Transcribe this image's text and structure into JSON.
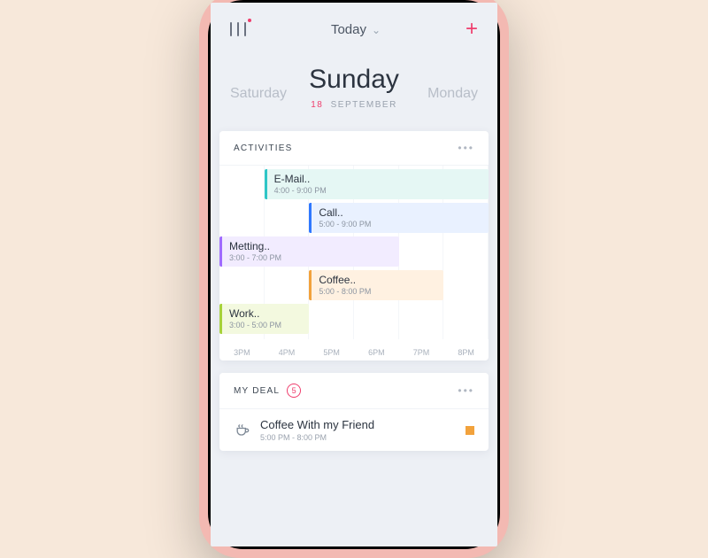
{
  "topbar": {
    "title": "Today"
  },
  "dayHeader": {
    "prev": "Saturday",
    "current": "Sunday",
    "next": "Monday",
    "dateNum": "18",
    "month": "SEPTEMBER"
  },
  "activities": {
    "title": "ACTIVITIES",
    "axis": [
      "3PM",
      "4PM",
      "5PM",
      "6PM",
      "7PM",
      "8PM"
    ],
    "events": [
      {
        "title": "E-Mail..",
        "time": "4:00 - 9:00 PM",
        "color": "#2ec6c6",
        "bg": "#e5f7f4",
        "startHour": 4.0,
        "endHour": 9.0
      },
      {
        "title": "Call..",
        "time": "5:00 - 9:00 PM",
        "color": "#2f78ff",
        "bg": "#e9f1ff",
        "startHour": 5.0,
        "endHour": 9.0
      },
      {
        "title": "Metting..",
        "time": "3:00 - 7:00 PM",
        "color": "#a06bff",
        "bg": "#f2ecff",
        "startHour": 3.0,
        "endHour": 7.0
      },
      {
        "title": "Coffee..",
        "time": "5:00 - 8:00 PM",
        "color": "#f2a23c",
        "bg": "#fff1e1",
        "startHour": 5.0,
        "endHour": 8.0
      },
      {
        "title": "Work..",
        "time": "3:00 - 5:00 PM",
        "color": "#a7d23a",
        "bg": "#f3f9df",
        "startHour": 3.0,
        "endHour": 5.0
      }
    ]
  },
  "deals": {
    "title": "MY DEAL",
    "count": "5",
    "items": [
      {
        "title": "Coffee With my Friend",
        "time": "5:00 PM - 8:00 PM",
        "color": "#f2a23c"
      }
    ]
  }
}
